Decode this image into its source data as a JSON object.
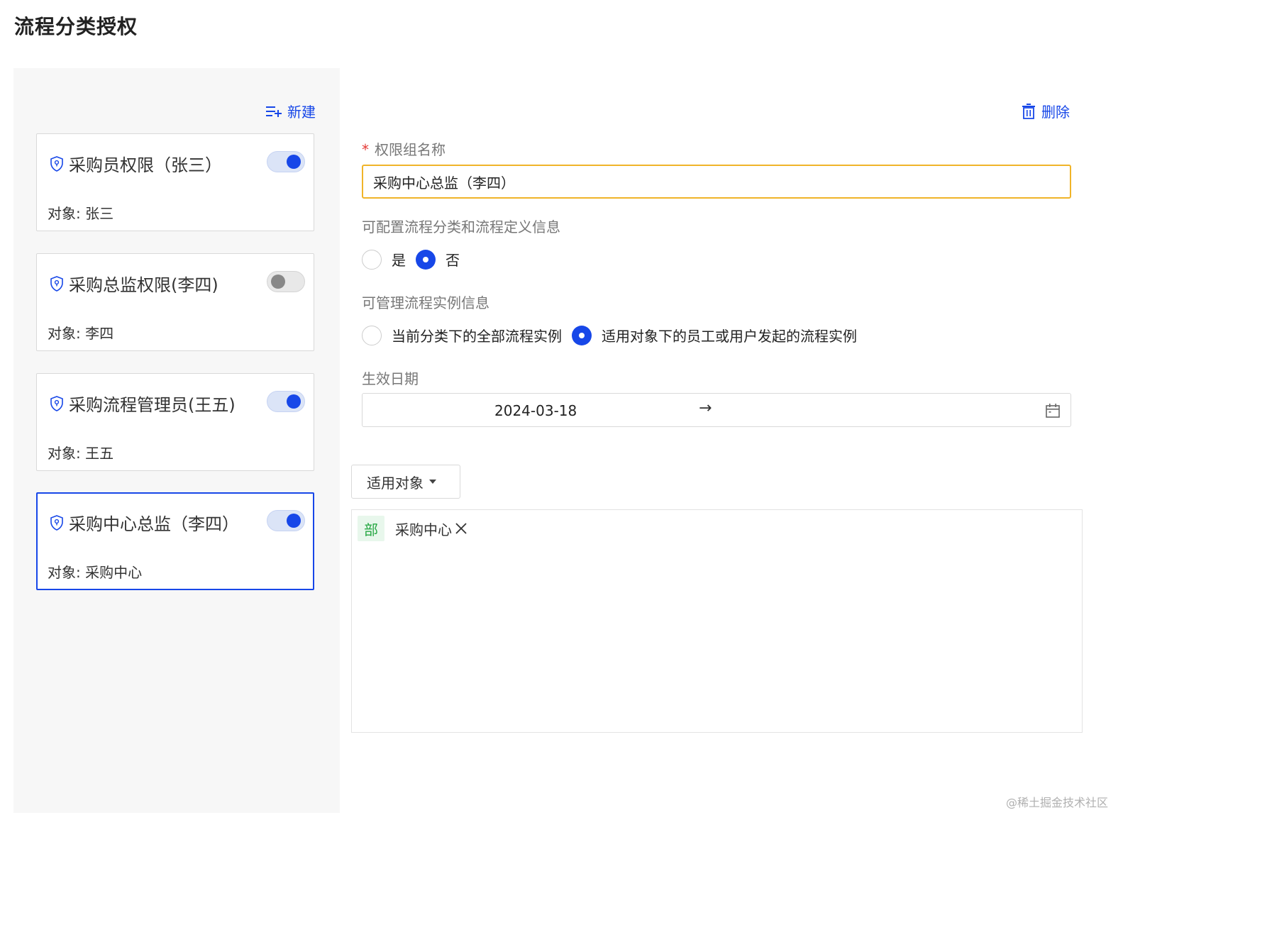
{
  "page": {
    "title": "流程分类授权"
  },
  "left": {
    "new_label": "新建",
    "cards": [
      {
        "name": "采购员权限（张三）",
        "target": "对象: 张三",
        "enabled": true,
        "active": false
      },
      {
        "name": "采购总监权限(李四)",
        "target": "对象: 李四",
        "enabled": false,
        "active": false
      },
      {
        "name": "采购流程管理员(王五)",
        "target": "对象: 王五",
        "enabled": true,
        "active": false
      },
      {
        "name": "采购中心总监（李四）",
        "target": "对象: 采购中心",
        "enabled": true,
        "active": true
      }
    ]
  },
  "form": {
    "delete_label": "删除",
    "required_mark": "*",
    "group_name_label": "权限组名称",
    "group_name_value": "采购中心总监（李四）",
    "config_label": "可配置流程分类和流程定义信息",
    "config_options": [
      "是",
      "否"
    ],
    "config_selected": "否",
    "manage_label": "可管理流程实例信息",
    "manage_options": [
      "当前分类下的全部流程实例",
      "适用对象下的员工或用户发起的流程实例"
    ],
    "manage_selected": "适用对象下的员工或用户发起的流程实例",
    "date_label": "生效日期",
    "date_start": "2024-03-18",
    "date_separator": "→"
  },
  "scope": {
    "dropdown_label": "适用对象",
    "tags": [
      {
        "badge": "部",
        "text": "采购中心"
      }
    ]
  },
  "watermark": "@稀土掘金技术社区",
  "colors": {
    "accent": "#1747e8",
    "focus_border": "#f0b429",
    "dept_badge": "#27a844"
  }
}
